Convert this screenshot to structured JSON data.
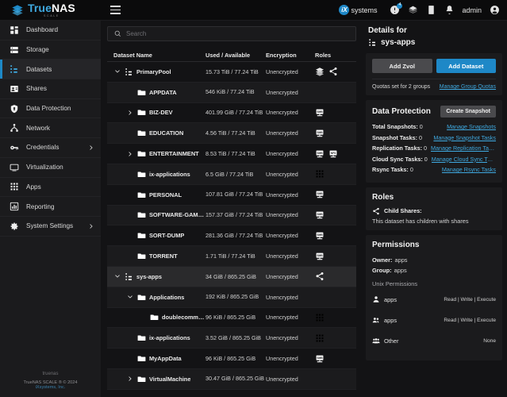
{
  "brand": {
    "name_blue": "True",
    "name_white": "NAS",
    "sub": "SCALE"
  },
  "topbar": {
    "ix_mark": "iX",
    "ix_word": "systems",
    "icons": [
      {
        "name": "power-status-icon",
        "badge": "4"
      },
      {
        "name": "jobs-icon",
        "badge": ""
      },
      {
        "name": "tasks-icon",
        "badge": ""
      },
      {
        "name": "alerts-bell-icon",
        "badge": ""
      }
    ],
    "admin_label": "admin"
  },
  "sidebar": {
    "items": [
      {
        "label": "Dashboard",
        "icon": "dashboard-icon",
        "active": false,
        "expandable": false
      },
      {
        "label": "Storage",
        "icon": "storage-icon",
        "active": false,
        "expandable": false
      },
      {
        "label": "Datasets",
        "icon": "datasets-icon",
        "active": true,
        "expandable": false
      },
      {
        "label": "Shares",
        "icon": "shares-icon",
        "active": false,
        "expandable": false
      },
      {
        "label": "Data Protection",
        "icon": "shield-icon",
        "active": false,
        "expandable": false
      },
      {
        "label": "Network",
        "icon": "network-icon",
        "active": false,
        "expandable": false
      },
      {
        "label": "Credentials",
        "icon": "key-icon",
        "active": false,
        "expandable": true
      },
      {
        "label": "Virtualization",
        "icon": "monitor-icon",
        "active": false,
        "expandable": false
      },
      {
        "label": "Apps",
        "icon": "apps-grid-icon",
        "active": false,
        "expandable": false
      },
      {
        "label": "Reporting",
        "icon": "reporting-chart-icon",
        "active": false,
        "expandable": false
      },
      {
        "label": "System Settings",
        "icon": "gear-icon",
        "active": false,
        "expandable": true
      }
    ],
    "footer": {
      "line1": "truenas",
      "line2": "TrueNAS SCALE ® © 2024",
      "line3": "iXsystems, Inc."
    }
  },
  "search": {
    "placeholder": "Search",
    "value": ""
  },
  "table": {
    "columns": [
      "Dataset Name",
      "Used / Available",
      "Encryption",
      "Roles"
    ],
    "rows": [
      {
        "name": "PrimaryPool",
        "depth": 0,
        "icon": "pool-icon",
        "twisty": "down",
        "used": "15.73 TiB / 77.24 TiB",
        "encryption": "Unencrypted",
        "roles": [
          "pool-icon-small",
          "share-icon"
        ],
        "selected": false,
        "shaded": false
      },
      {
        "name": "APPDATA",
        "depth": 1,
        "icon": "folder-icon",
        "twisty": "none",
        "used": "546 KiB / 77.24 TiB",
        "encryption": "Unencrypted",
        "roles": [],
        "selected": false,
        "shaded": true
      },
      {
        "name": "BIZ-DEV",
        "depth": 1,
        "icon": "folder-icon",
        "twisty": "right",
        "used": "401.99 GiB / 77.24 TiB",
        "encryption": "Unencrypted",
        "roles": [
          "smb-icon"
        ],
        "selected": false,
        "shaded": false
      },
      {
        "name": "EDUCATION",
        "depth": 1,
        "icon": "folder-icon",
        "twisty": "none",
        "used": "4.56 TiB / 77.24 TiB",
        "encryption": "Unencrypted",
        "roles": [
          "smb-icon"
        ],
        "selected": false,
        "shaded": true
      },
      {
        "name": "ENTERTAINMENT",
        "depth": 1,
        "icon": "folder-icon",
        "twisty": "right",
        "used": "8.53 TiB / 77.24 TiB",
        "encryption": "Unencrypted",
        "roles": [
          "smb-icon",
          "nfs-icon"
        ],
        "selected": false,
        "shaded": false
      },
      {
        "name": "ix-applications",
        "depth": 1,
        "icon": "folder-icon",
        "twisty": "none",
        "used": "6.5 GiB / 77.24 TiB",
        "encryption": "Unencrypted",
        "roles": [
          "apps-grid-icon"
        ],
        "selected": false,
        "shaded": true
      },
      {
        "name": "PERSONAL",
        "depth": 1,
        "icon": "folder-icon",
        "twisty": "none",
        "used": "107.81 GiB / 77.24 TiB",
        "encryption": "Unencrypted",
        "roles": [
          "smb-icon"
        ],
        "selected": false,
        "shaded": false
      },
      {
        "name": "SOFTWARE-GAMES",
        "depth": 1,
        "icon": "folder-icon",
        "twisty": "none",
        "used": "157.37 GiB / 77.24 TiB",
        "encryption": "Unencrypted",
        "roles": [
          "smb-icon"
        ],
        "selected": false,
        "shaded": true
      },
      {
        "name": "SORT-DUMP",
        "depth": 1,
        "icon": "folder-icon",
        "twisty": "none",
        "used": "281.36 GiB / 77.24 TiB",
        "encryption": "Unencrypted",
        "roles": [
          "smb-icon"
        ],
        "selected": false,
        "shaded": false
      },
      {
        "name": "TORRENT",
        "depth": 1,
        "icon": "folder-icon",
        "twisty": "none",
        "used": "1.71 TiB / 77.24 TiB",
        "encryption": "Unencrypted",
        "roles": [
          "smb-icon"
        ],
        "selected": false,
        "shaded": true
      },
      {
        "name": "sys-apps",
        "depth": 0,
        "icon": "pool-icon",
        "twisty": "down",
        "used": "34 GiB / 865.25 GiB",
        "encryption": "Unencrypted",
        "roles": [
          "share-icon"
        ],
        "selected": true,
        "shaded": false
      },
      {
        "name": "Applications",
        "depth": 1,
        "icon": "folder-icon",
        "twisty": "down",
        "used": "192 KiB / 865.25 GiB",
        "encryption": "Unencrypted",
        "roles": [],
        "selected": false,
        "shaded": true
      },
      {
        "name": "doublecommander",
        "depth": 2,
        "icon": "folder-icon",
        "twisty": "none",
        "used": "96 KiB / 865.25 GiB",
        "encryption": "Unencrypted",
        "roles": [
          "apps-grid-icon"
        ],
        "selected": false,
        "shaded": false
      },
      {
        "name": "ix-applications",
        "depth": 1,
        "icon": "folder-icon",
        "twisty": "none",
        "used": "3.52 GiB / 865.25 GiB",
        "encryption": "Unencrypted",
        "roles": [
          "apps-grid-icon"
        ],
        "selected": false,
        "shaded": true
      },
      {
        "name": "MyAppData",
        "depth": 1,
        "icon": "folder-icon",
        "twisty": "none",
        "used": "96 KiB / 865.25 GiB",
        "encryption": "Unencrypted",
        "roles": [
          "smb-icon"
        ],
        "selected": false,
        "shaded": false
      },
      {
        "name": "VirtualMachine",
        "depth": 1,
        "icon": "folder-icon",
        "twisty": "right",
        "used": "30.47 GiB / 865.25 GiB",
        "encryption": "Unencrypted",
        "roles": [],
        "selected": false,
        "shaded": true
      }
    ]
  },
  "details": {
    "title": "Details for",
    "dataset": "sys-apps",
    "add_zvol": "Add Zvol",
    "add_dataset": "Add Dataset",
    "quota_text": "Quotas set for 2 groups",
    "quota_link": "Manage Group Quotas",
    "data_protection": {
      "title": "Data Protection",
      "create_snapshot": "Create Snapshot",
      "lines": [
        {
          "label": "Total Snapshots:",
          "value": "0",
          "link": "Manage Snapshots"
        },
        {
          "label": "Snapshot Tasks:",
          "value": "0",
          "link": "Manage Snapshot Tasks"
        },
        {
          "label": "Replication Tasks:",
          "value": "0",
          "link": "Manage Replication Tas…"
        },
        {
          "label": "Cloud Sync Tasks:",
          "value": "0",
          "link": "Manage Cloud Sync Tas…"
        },
        {
          "label": "Rsync Tasks:",
          "value": "0",
          "link": "Manage Rsync Tasks"
        }
      ]
    },
    "roles": {
      "title": "Roles",
      "child_shares_label": "Child Shares:",
      "child_shares_desc": "This dataset has children with shares"
    },
    "permissions": {
      "title": "Permissions",
      "owner_label": "Owner:",
      "owner_value": "apps",
      "group_label": "Group:",
      "group_value": "apps",
      "unix_title": "Unix Permissions",
      "entries": [
        {
          "icon": "user-icon",
          "who": "apps",
          "rights": "Read | Write | Execute"
        },
        {
          "icon": "group-icon",
          "who": "apps",
          "rights": "Read | Write | Execute"
        },
        {
          "icon": "others-icon",
          "who": "Other",
          "rights": "None"
        }
      ]
    }
  },
  "colors": {
    "accent": "#1e88c7",
    "link": "#3fa9e0",
    "bg": "#131315",
    "panel": "#1b1b1d"
  }
}
